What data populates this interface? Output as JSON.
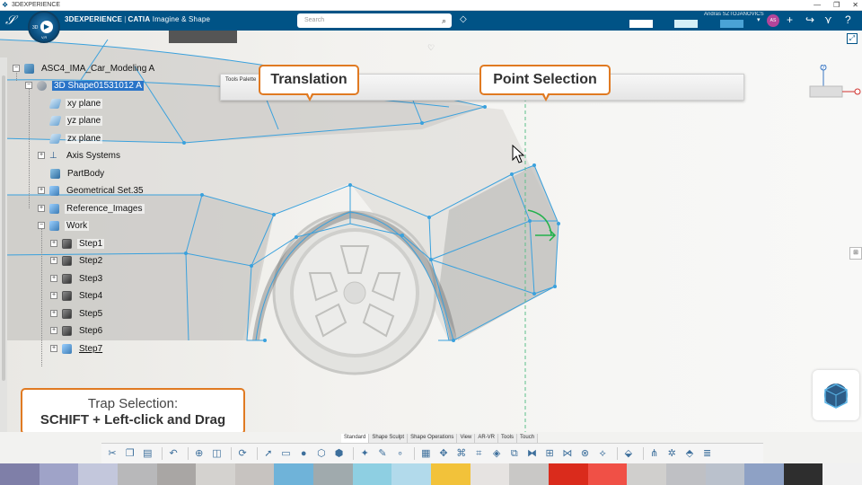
{
  "os_bar": {
    "title": "3DEXPERIENCE",
    "controls": [
      "—",
      "❐",
      "✕"
    ]
  },
  "header": {
    "brand_prefix": "3DEXPERIENCE",
    "brand_app": "CATIA",
    "brand_role": "Imagine & Shape",
    "compass_label": "3D",
    "compass_v": "V,R",
    "search_placeholder": "Search",
    "user_name": "Andras SZTOJANOVICS",
    "avatar_initials": "AS"
  },
  "tree": {
    "items": [
      {
        "label": "ASC4_IMA_Car_Modeling A",
        "icon": "product-icon"
      },
      {
        "label": "3D Shape01531012 A",
        "icon": "shape-icon",
        "selected": true
      },
      {
        "label": "xy plane",
        "icon": "plane-icon"
      },
      {
        "label": "yz plane",
        "icon": "plane-icon"
      },
      {
        "label": "zx plane",
        "icon": "plane-icon"
      },
      {
        "label": "Axis Systems",
        "icon": "axis-icon"
      },
      {
        "label": "PartBody",
        "icon": "body-icon"
      },
      {
        "label": "Geometrical Set.35",
        "icon": "geoset-icon"
      },
      {
        "label": "Reference_Images",
        "icon": "geoset-icon"
      },
      {
        "label": "Work",
        "icon": "geoset-icon"
      },
      {
        "label": "Step1",
        "icon": "step-icon"
      },
      {
        "label": "Step2",
        "icon": "step-icon"
      },
      {
        "label": "Step3",
        "icon": "step-icon"
      },
      {
        "label": "Step4",
        "icon": "step-icon"
      },
      {
        "label": "Step5",
        "icon": "step-icon"
      },
      {
        "label": "Step6",
        "icon": "step-icon"
      },
      {
        "label": "Step7",
        "icon": "step-icon"
      }
    ]
  },
  "callouts": {
    "translation": "Translation",
    "point_selection": "Point Selection",
    "trap_line1": "Trap Selection:",
    "trap_line2": "SCHIFT + Left-click and Drag"
  },
  "tools_palette": {
    "title": "Tools Palette"
  },
  "view_axis": {
    "z_label": "Z"
  },
  "action_tabs": [
    "Standard",
    "Shape Sculpt",
    "Shape Operations",
    "View",
    "AR-VR",
    "Tools",
    "Touch"
  ],
  "toolbar_icons": [
    "cut-icon",
    "copy-icon",
    "paste-icon",
    "undo-icon",
    "zoom-icon",
    "view-icon",
    "refresh-icon",
    "select-icon",
    "rectangle-icon",
    "sphere-icon",
    "shape-icon",
    "shape2-icon",
    "sculpt-icon",
    "pencil-icon",
    "dot-icon",
    "grid-icon",
    "transform-icon",
    "mesh-icon",
    "mesh2-icon",
    "cube-icon",
    "mirror-icon",
    "symmetry-icon",
    "subdivide-icon",
    "crease-icon",
    "weld-icon",
    "split-icon",
    "merge-icon",
    "align-icon",
    "snap-icon",
    "extrude-icon",
    "bridge-icon",
    "smooth-icon",
    "layers-icon"
  ],
  "colors": {
    "header_bg": "#005386",
    "accent_orange": "#e07a22",
    "selection_blue": "#2a74c8",
    "palette": [
      "#7f7fa8",
      "#9fa3c8",
      "#c3c7dc",
      "#b8b8ba",
      "#a9a6a4",
      "#d4d2cf",
      "#c7c3c0",
      "#6fb3d9",
      "#a0aaad",
      "#8ecfe2",
      "#b2daeb",
      "#f2c23a",
      "#e6e3e1",
      "#c9c8c6",
      "#da2b1c",
      "#f05046",
      "#d0cfcd",
      "#bfc0c4",
      "#bac1cc",
      "#8ea1c5",
      "#2e2e2e",
      "#f1f1f1"
    ]
  }
}
